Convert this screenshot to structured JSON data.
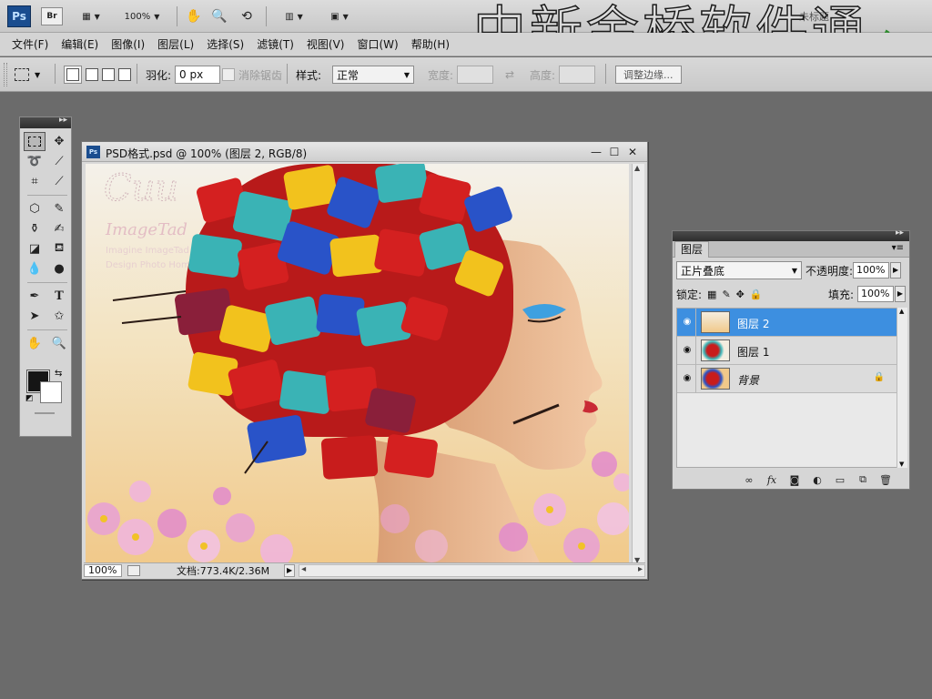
{
  "app": {
    "logo": "Ps",
    "bridge_label": "Br",
    "zoom": "100%",
    "watermark": "中新金桥软件通",
    "watermark_small": "未标题"
  },
  "menu": [
    "文件(F)",
    "编辑(E)",
    "图像(I)",
    "图层(L)",
    "选择(S)",
    "滤镜(T)",
    "视图(V)",
    "窗口(W)",
    "帮助(H)"
  ],
  "options": {
    "feather_label": "羽化:",
    "feather_value": "0 px",
    "antialias_label": "消除锯齿",
    "style_label": "样式:",
    "style_value": "正常",
    "width_label": "宽度:",
    "height_label": "高度:",
    "refine_edge": "调整边缘..."
  },
  "document": {
    "title": "PSD格式.psd @ 100% (图层 2, RGB/8)",
    "status_zoom": "100%",
    "status_info": "文档:773.4K/2.36M"
  },
  "layers_panel": {
    "tab": "图层",
    "blend_mode": "正片叠底",
    "opacity_label": "不透明度:",
    "opacity_value": "100%",
    "lock_label": "锁定:",
    "fill_label": "填充:",
    "fill_value": "100%",
    "layers": [
      {
        "name": "图层 2",
        "selected": true,
        "locked": false
      },
      {
        "name": "图层 1",
        "selected": false,
        "locked": false
      },
      {
        "name": "背景",
        "selected": false,
        "locked": true
      }
    ]
  },
  "colors": {
    "selection_blue": "#3d8fe0",
    "foreground": "#151515",
    "background": "#ffffff",
    "workspace": "#6b6b6b"
  }
}
